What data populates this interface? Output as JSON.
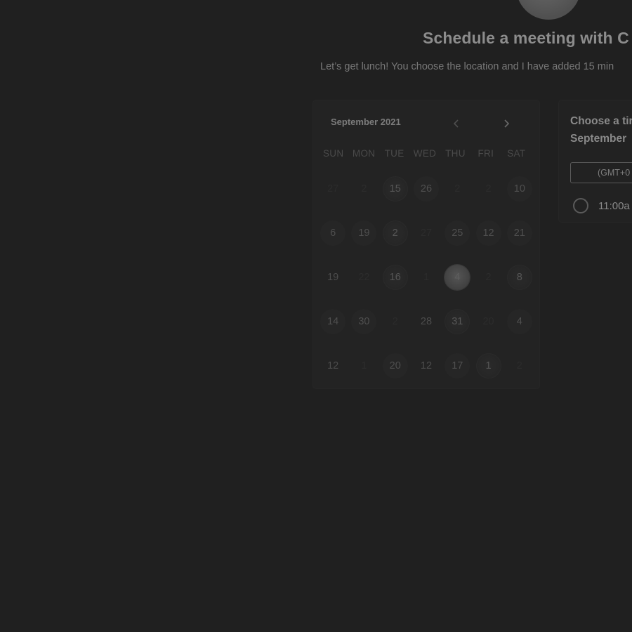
{
  "header": {
    "title": "Schedule a meeting with C",
    "subtitle": "Let’s get lunch! You choose the location and I have added 15 min"
  },
  "calendar": {
    "month_label": "September 2021",
    "prev_icon": "chevron-left-icon",
    "next_icon": "chevron-right-icon",
    "weekdays": [
      "SUN",
      "MON",
      "TUE",
      "WED",
      "THU",
      "FRI",
      "SAT"
    ],
    "weeks": [
      [
        {
          "label": "27",
          "state": "muted"
        },
        {
          "label": "2",
          "state": "muted"
        },
        {
          "label": "15",
          "state": "busy"
        },
        {
          "label": "26",
          "state": "avail"
        },
        {
          "label": "2",
          "state": "muted"
        },
        {
          "label": "2",
          "state": "muted"
        },
        {
          "label": "10",
          "state": "avail"
        }
      ],
      [
        {
          "label": "6",
          "state": "avail"
        },
        {
          "label": "19",
          "state": "avail"
        },
        {
          "label": "2",
          "state": "busy"
        },
        {
          "label": "27",
          "state": "muted"
        },
        {
          "label": "25",
          "state": "avail"
        },
        {
          "label": "12",
          "state": "avail"
        },
        {
          "label": "21",
          "state": "avail"
        }
      ],
      [
        {
          "label": "19",
          "state": "plain"
        },
        {
          "label": "22",
          "state": "muted"
        },
        {
          "label": "16",
          "state": "busy"
        },
        {
          "label": "1",
          "state": "muted"
        },
        {
          "label": "4",
          "state": "selected"
        },
        {
          "label": "2",
          "state": "muted"
        },
        {
          "label": "8",
          "state": "busy"
        }
      ],
      [
        {
          "label": "14",
          "state": "avail"
        },
        {
          "label": "30",
          "state": "avail"
        },
        {
          "label": "2",
          "state": "muted"
        },
        {
          "label": "28",
          "state": "plain"
        },
        {
          "label": "31",
          "state": "busy"
        },
        {
          "label": "20",
          "state": "muted"
        },
        {
          "label": "4",
          "state": "avail"
        }
      ],
      [
        {
          "label": "12",
          "state": "plain"
        },
        {
          "label": "1",
          "state": "muted"
        },
        {
          "label": "20",
          "state": "avail"
        },
        {
          "label": "12",
          "state": "plain"
        },
        {
          "label": "17",
          "state": "avail"
        },
        {
          "label": "1",
          "state": "busy"
        },
        {
          "label": "2",
          "state": "muted"
        }
      ]
    ]
  },
  "time_panel": {
    "heading_line1": "Choose a tir",
    "heading_line2": "September",
    "timezone": "(GMT+0",
    "slots": [
      "11:00a"
    ]
  }
}
